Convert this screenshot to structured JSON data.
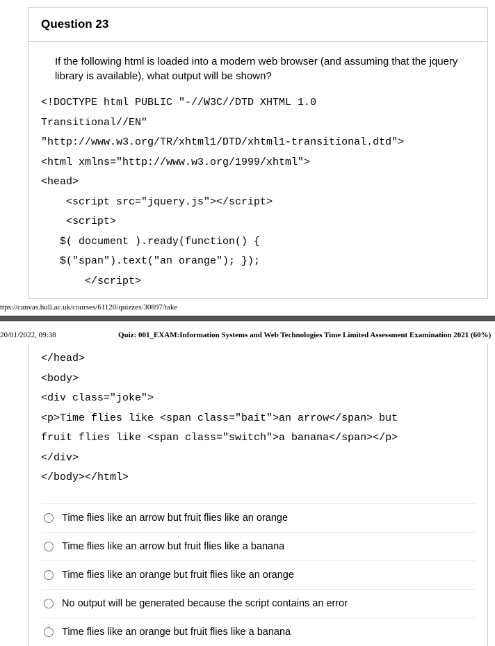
{
  "question": {
    "number_label": "Question 23",
    "prompt": "If the following html is loaded into a modern web browser (and assuming that the jquery library is available), what output will be shown?"
  },
  "code_block_1": "<!DOCTYPE html PUBLIC \"-//W3C//DTD XHTML 1.0\nTransitional//EN\"\n\"http://www.w3.org/TR/xhtml1/DTD/xhtml1-transitional.dtd\">\n<html xmlns=\"http://www.w3.org/1999/xhtml\">\n<head>\n    <script src=\"jquery.js\"></script>\n    <script>\n   $( document ).ready(function() {\n   $(\"span\").text(\"an orange\"); });\n       </script>",
  "footer_url": "ttps://canvas.hull.ac.uk/courses/61120/quizzes/30897/take",
  "page_header": {
    "date": "20/01/2022, 09:38",
    "quiz_title": "Quiz: 001_EXAM:Information Systems and Web Technologies Time Limited Assessment Examination 2021 (60%)"
  },
  "code_block_2": "</head>\n<body>\n<div class=\"joke\">\n<p>Time flies like <span class=\"bait\">an arrow</span> but\nfruit flies like <span class=\"switch\">a banana</span></p>\n</div>\n</body></html>",
  "answers": [
    "Time flies like an arrow but fruit flies like an orange",
    "Time flies like an arrow but fruit flies like a banana",
    "Time flies like an orange but fruit flies like an orange",
    "No output will be generated because the script contains an error",
    "Time flies like an orange but fruit flies like a banana"
  ]
}
